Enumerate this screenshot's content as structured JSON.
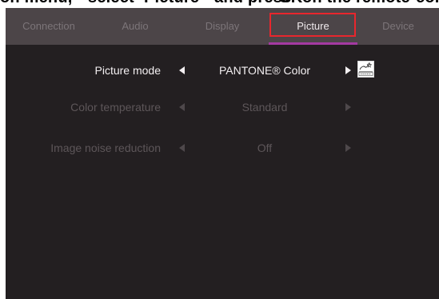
{
  "caption": {
    "part1": "on menu,",
    "part2": "select",
    "part3": "Picture",
    "part4": "and press",
    "part5": "OK",
    "part6": "on the remote",
    "part7": "contr"
  },
  "tabs": [
    {
      "label": "Connection",
      "active": false
    },
    {
      "label": "Audio",
      "active": false
    },
    {
      "label": "Display",
      "active": false
    },
    {
      "label": "Picture",
      "active": true
    },
    {
      "label": "Device",
      "active": false
    }
  ],
  "settings": [
    {
      "label": "Picture mode",
      "value": "PANTONE® Color",
      "active": true
    },
    {
      "label": "Color temperature",
      "value": "Standard",
      "active": false
    },
    {
      "label": "Image noise reduction",
      "value": "Off",
      "active": false
    }
  ],
  "badge": {
    "icon": "energy-star-icon",
    "text": "ENERGY STAR"
  },
  "colors": {
    "background": "#231f21",
    "tab_bar": "#4c4548",
    "active_tab_underline": "#a43aa2",
    "highlight_box": "#e8262d",
    "active_text": "#f3eff1",
    "inactive_text": "#5d5659"
  }
}
